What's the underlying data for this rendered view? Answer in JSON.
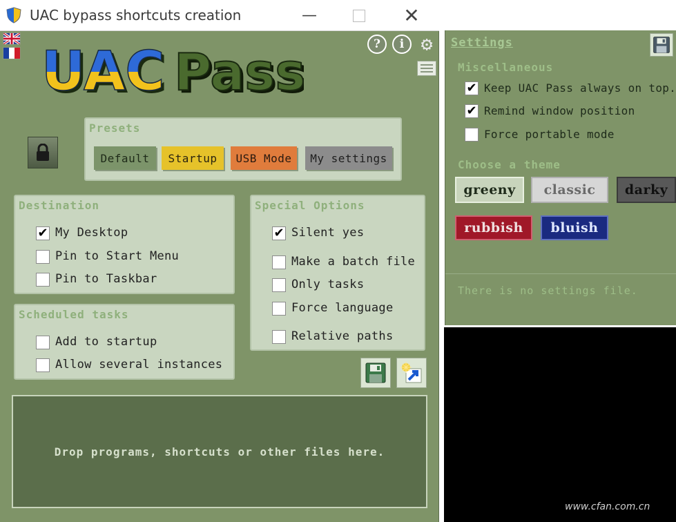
{
  "window": {
    "title": "UAC bypass shortcuts creation",
    "minimize_glyph": "—",
    "close_glyph": "✕"
  },
  "logo": {
    "part1": "UAC",
    "part2": "Pass"
  },
  "top_icons": {
    "help": "?",
    "info": "i",
    "gear": "⚙"
  },
  "presets": {
    "title": "Presets",
    "buttons": [
      {
        "label": "Default",
        "color": "#7c946a"
      },
      {
        "label": "Startup",
        "color": "#e6c22a"
      },
      {
        "label": "USB Mode",
        "color": "#e07c3c"
      },
      {
        "label": "My settings",
        "color": "#8c8c8c"
      }
    ]
  },
  "destination": {
    "title": "Destination",
    "options": [
      {
        "label": "My Desktop",
        "checked": true
      },
      {
        "label": "Pin to Start Menu",
        "checked": false
      },
      {
        "label": "Pin to Taskbar",
        "checked": false
      }
    ]
  },
  "scheduled": {
    "title": "Scheduled tasks",
    "options": [
      {
        "label": "Add to startup",
        "checked": false
      },
      {
        "label": "Allow several instances",
        "checked": false
      }
    ]
  },
  "special": {
    "title": "Special Options",
    "options": [
      {
        "label": "Silent yes",
        "checked": true
      },
      {
        "label": "Make a batch file",
        "checked": false
      },
      {
        "label": "Only tasks",
        "checked": false
      },
      {
        "label": "Force language",
        "checked": false
      },
      {
        "label": "Relative paths",
        "checked": false
      }
    ]
  },
  "drop_zone": {
    "text": "Drop programs, shortcuts or other files here."
  },
  "settings": {
    "title": "Settings",
    "misc_heading": "Miscellaneous",
    "misc_options": [
      {
        "label": "Keep UAC Pass always on top.",
        "checked": true
      },
      {
        "label": "Remind window position",
        "checked": true
      },
      {
        "label": "Force portable mode",
        "checked": false
      }
    ],
    "theme_heading": "Choose a theme",
    "themes": {
      "greeny": "greeny",
      "classic": "classic",
      "darky": "darky",
      "rubbish": "rubbish",
      "bluish": "bluish"
    },
    "status": "There is no settings file."
  },
  "watermark": "www.cfan.com.cn",
  "check_glyph": "✔",
  "colors": {
    "window_bg": "#7f9468",
    "group_bg": "#c9d6c0",
    "drop_zone_bg": "#5b6e4b",
    "heading_green": "#8fb07c"
  }
}
